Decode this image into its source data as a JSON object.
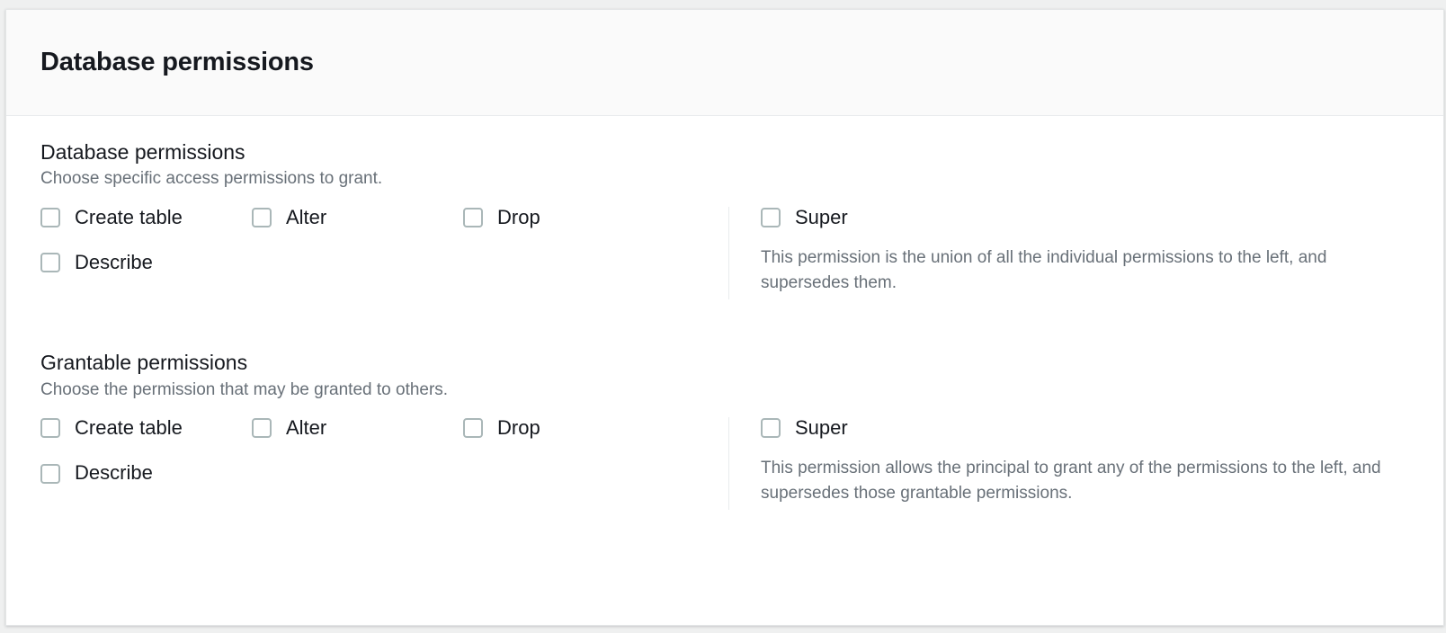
{
  "panel": {
    "title": "Database permissions"
  },
  "sections": [
    {
      "heading": "Database permissions",
      "description": "Choose specific access permissions to grant.",
      "permissions": [
        {
          "label": "Create table",
          "checked": false
        },
        {
          "label": "Alter",
          "checked": false
        },
        {
          "label": "Drop",
          "checked": false
        },
        {
          "label": "Describe",
          "checked": false
        }
      ],
      "super": {
        "label": "Super",
        "checked": false,
        "hint": "This permission is the union of all the individual permissions to the left, and supersedes them."
      }
    },
    {
      "heading": "Grantable permissions",
      "description": "Choose the permission that may be granted to others.",
      "permissions": [
        {
          "label": "Create table",
          "checked": false
        },
        {
          "label": "Alter",
          "checked": false
        },
        {
          "label": "Drop",
          "checked": false
        },
        {
          "label": "Describe",
          "checked": false
        }
      ],
      "super": {
        "label": "Super",
        "checked": false,
        "hint": "This permission allows the principal to grant any of the permissions to the left, and supersedes those grantable permissions."
      }
    }
  ],
  "colors": {
    "page_background": "#eff0f0",
    "panel_background": "#ffffff",
    "header_background": "#fafafa",
    "border": "#e9ebed",
    "text_primary": "#16191f",
    "text_secondary": "#687078",
    "checkbox_border": "#aab7b8"
  }
}
